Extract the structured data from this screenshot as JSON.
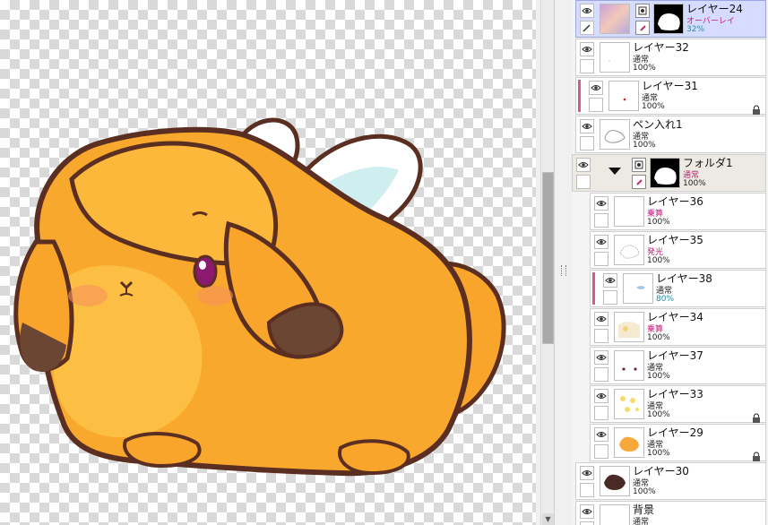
{
  "layers": [
    {
      "id": "l24",
      "name": "レイヤー24",
      "mode": "オーバーレイ",
      "opacity": "32%",
      "mode_color": "pink",
      "opacity_color": "teal",
      "selected": true,
      "thumb": "overlay"
    },
    {
      "id": "l32",
      "name": "レイヤー32",
      "mode": "通常",
      "opacity": "100%",
      "thumb": "blank-dot"
    },
    {
      "id": "l31",
      "name": "レイヤー31",
      "mode": "通常",
      "opacity": "100%",
      "clip_marked": true,
      "locked": true,
      "thumb": "red-dot"
    },
    {
      "id": "pen1",
      "name": "ペン入れ1",
      "mode": "通常",
      "opacity": "100%",
      "thumb": "lineart"
    },
    {
      "id": "folder1",
      "name": "フォルダ1",
      "mode": "通常",
      "opacity": "100%",
      "mode_color": "pink",
      "folder": true,
      "thumb": "silhouette"
    },
    {
      "id": "l36",
      "name": "レイヤー36",
      "mode": "乗算",
      "opacity": "100%",
      "mode_color": "pink",
      "thumb": "blank"
    },
    {
      "id": "l35",
      "name": "レイヤー35",
      "mode": "発光",
      "opacity": "100%",
      "mode_color": "pink",
      "thumb": "sketch"
    },
    {
      "id": "l38",
      "name": "レイヤー38",
      "mode": "通常",
      "opacity": "80%",
      "opacity_color": "teal",
      "clip_marked": true,
      "thumb": "blue"
    },
    {
      "id": "l34",
      "name": "レイヤー34",
      "mode": "乗算",
      "opacity": "100%",
      "mode_color": "pink",
      "thumb": "yellowish"
    },
    {
      "id": "l37",
      "name": "レイヤー37",
      "mode": "通常",
      "opacity": "100%",
      "thumb": "dots"
    },
    {
      "id": "l33",
      "name": "レイヤー33",
      "mode": "通常",
      "opacity": "100%",
      "locked": true,
      "thumb": "yellow"
    },
    {
      "id": "l29",
      "name": "レイヤー29",
      "mode": "通常",
      "opacity": "100%",
      "locked": true,
      "thumb": "orange"
    },
    {
      "id": "l30",
      "name": "レイヤー30",
      "mode": "通常",
      "opacity": "100%",
      "thumb": "dark"
    },
    {
      "id": "bg",
      "name": "背景",
      "mode": "通常",
      "opacity": "",
      "thumb": "blank"
    }
  ],
  "colors": {
    "selected_bg": "#d6dcff",
    "clip_marker": "#e05488",
    "mode_pink": "#c0207a",
    "opacity_teal": "#2a8aa0",
    "fur": "#f8a52a",
    "outline": "#5a2e20"
  },
  "icons": {
    "eye": "eye-icon",
    "pen": "pen-icon",
    "lock": "lock-icon",
    "mask": "mask-icon",
    "clip": "clip-icon",
    "folder_open": "folder-expand-icon"
  }
}
